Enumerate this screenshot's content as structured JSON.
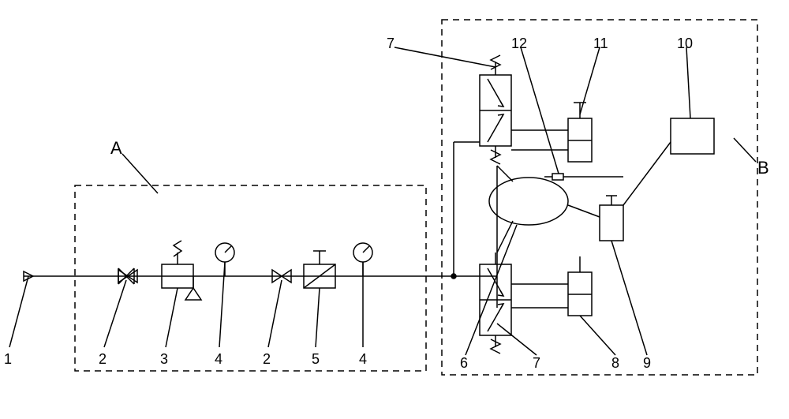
{
  "labels": {
    "n1": "1",
    "n2": "2",
    "n3": "3",
    "n4": "4",
    "n5": "5",
    "n6": "6",
    "n7": "7",
    "n8": "8",
    "n9": "9",
    "n10": "10",
    "n11": "11",
    "n12": "12",
    "A": "A",
    "B": "B"
  },
  "chart_data": {
    "type": "diagram",
    "title": "Pneumatic schematic with labeled components inside two dashed subsystems A and B",
    "subsystems": [
      {
        "name": "A",
        "contents": [
          "2 (stop valve, two instances)",
          "3 (pressure reducing/filter regulator)",
          "4 (pressure gauge, two instances)",
          "5 (precision regulator/filter)"
        ]
      },
      {
        "name": "B",
        "contents": [
          "6 (air bag / oval chamber)",
          "7 (two-position solenoid valve, two instances)",
          "8 (pneumatic cylinder, lower)",
          "9 (pneumatic cylinder/block, middle-right)",
          "10 (controller box)",
          "11 (pneumatic cylinder, upper)",
          "12 (sensor/probe near chamber)"
        ]
      }
    ],
    "components": [
      {
        "id": 1,
        "name": "air inlet / supply (triangle)"
      },
      {
        "id": 2,
        "name": "stop valve (bowtie)",
        "count": 2
      },
      {
        "id": 3,
        "name": "filter-regulator with spring and drain"
      },
      {
        "id": 4,
        "name": "pressure gauge (circle with pointer)",
        "count": 2
      },
      {
        "id": 5,
        "name": "precision regulator / filter (box with diagonal and T adjuster)"
      },
      {
        "id": 6,
        "name": "oval air chamber / bag"
      },
      {
        "id": 7,
        "name": "two-position solenoid directional valve",
        "count": 2
      },
      {
        "id": 8,
        "name": "pneumatic cylinder (lower)"
      },
      {
        "id": 9,
        "name": "pneumatic cylinder / block (right of chamber)"
      },
      {
        "id": 10,
        "name": "controller / electronic box"
      },
      {
        "id": 11,
        "name": "pneumatic cylinder (upper)"
      },
      {
        "id": 12,
        "name": "sensor / probe at chamber top-right"
      }
    ],
    "connections": [
      {
        "from": 1,
        "to": 2,
        "type": "pneumatic"
      },
      {
        "from": 2,
        "to": 3,
        "type": "pneumatic"
      },
      {
        "from": 3,
        "to": 4,
        "type": "pneumatic"
      },
      {
        "from": 4,
        "to": 2,
        "type": "pneumatic"
      },
      {
        "from": 2,
        "to": 5,
        "type": "pneumatic"
      },
      {
        "from": 5,
        "to": 4,
        "type": "pneumatic"
      },
      {
        "from": 4,
        "to": "junction→7(upper) & 7(lower)",
        "type": "pneumatic"
      },
      {
        "from": "7 upper",
        "to": 11,
        "type": "pneumatic"
      },
      {
        "from": "7 lower",
        "to": 8,
        "type": "pneumatic"
      },
      {
        "from": 6,
        "to": 9,
        "type": "mechanical/pneumatic"
      },
      {
        "from": 6,
        "to": 12,
        "type": "signal"
      },
      {
        "from": 12,
        "to": 10,
        "type": "signal"
      },
      {
        "from": "junction",
        "to": "7 upper (solenoid pilot)",
        "type": "electrical"
      }
    ]
  }
}
